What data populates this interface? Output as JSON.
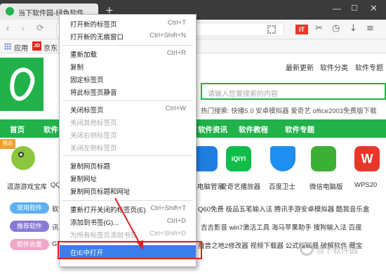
{
  "browser": {
    "tab_title": "当下软件园-绿色软件_最新",
    "new_tab_glyph": "+",
    "win_min": "—",
    "win_max": "☐",
    "win_close": "✕",
    "nav_back": "‹",
    "nav_fwd": "›",
    "nav_reload": "⟳",
    "it_label": "IT",
    "toolbar_icons": [
      "cut-icon",
      "history-icon",
      "download-icon",
      "menu-icon"
    ],
    "toolbar_glyphs": [
      "✂",
      "◷",
      "↓",
      "≡"
    ]
  },
  "bookmarks": {
    "apps_label": "应用",
    "jd_badge": "JD",
    "jd_label": "京东"
  },
  "site": {
    "top_links": [
      "最新更新",
      "软件分类",
      "软件专题"
    ],
    "search_placeholder": "请输入您要搜索的内容",
    "hot_search": "热门搜索: 快播5.0   安卓模拟器   爱奇艺   office2003免费版下载",
    "nav": [
      "首页",
      "软件",
      "软件资讯",
      "软件教程",
      "软件专题"
    ],
    "badge": "精品",
    "apps": [
      {
        "label": "逗游游戏宝库"
      },
      {
        "label": "QQ"
      },
      {
        "label": "腾讯电脑管家"
      },
      {
        "label": "爱奇艺播放器"
      },
      {
        "label": "百度卫士"
      },
      {
        "label": "微信电脑版"
      },
      {
        "label": "WPS20"
      }
    ],
    "app_glyphs": [
      "",
      "",
      "",
      "iQIYI",
      "",
      "",
      "W"
    ],
    "categories": [
      {
        "label": "常用软件",
        "links": "Q60免费   极品五笔输入法   腾讯手游安卓模拟器   酷我音乐盒"
      },
      {
        "label": "推荐软件",
        "links": "吉吉影音   win7激活工具   海马苹果助手   搜狗输入法   百度"
      },
      {
        "label": "软件合集",
        "links": "魔兽之地2修改器   视频下载器   公式编辑器   破解软件   藏宝"
      }
    ],
    "category_prefixes": [
      "软件",
      "讯",
      "GT"
    ],
    "watermark": "当下软件园"
  },
  "context_menu": {
    "items": [
      {
        "label": "打开新的标签页",
        "shortcut": "Ctrl+T",
        "disabled": false
      },
      {
        "label": "打开新的无痕窗口",
        "shortcut": "Ctrl+Shift+N",
        "disabled": false
      },
      {
        "label": "重新加载",
        "shortcut": "Ctrl+R",
        "disabled": false
      },
      {
        "label": "复制",
        "shortcut": "",
        "disabled": false
      },
      {
        "label": "固定标签页",
        "shortcut": "",
        "disabled": false
      },
      {
        "label": "将此标签页静音",
        "shortcut": "",
        "disabled": false
      },
      {
        "label": "关闭标签页",
        "shortcut": "Ctrl+W",
        "disabled": false
      },
      {
        "label": "关闭其他标签页",
        "shortcut": "",
        "disabled": true
      },
      {
        "label": "关闭右侧标签页",
        "shortcut": "",
        "disabled": true
      },
      {
        "label": "关闭左侧标签页",
        "shortcut": "",
        "disabled": true
      },
      {
        "label": "复制网页标题",
        "shortcut": "",
        "disabled": false
      },
      {
        "label": "复制网址",
        "shortcut": "",
        "disabled": false
      },
      {
        "label": "复制网页标题和网址",
        "shortcut": "",
        "disabled": false
      },
      {
        "label": "重新打开关闭的标签页(E)",
        "shortcut": "Ctrl+Shift+T",
        "disabled": false
      },
      {
        "label": "添加到书签(G)...",
        "shortcut": "Ctrl+D",
        "disabled": false
      },
      {
        "label": "为所有标签页添加书签...",
        "shortcut": "Ctrl+Shift+D",
        "disabled": true
      },
      {
        "label": "在IE中打开",
        "shortcut": "",
        "disabled": false,
        "highlighted": true
      }
    ]
  },
  "colors": {
    "brand_green": "#21b24b",
    "menu_highlight": "#3a7ee9",
    "annotation_red": "#e02020"
  }
}
